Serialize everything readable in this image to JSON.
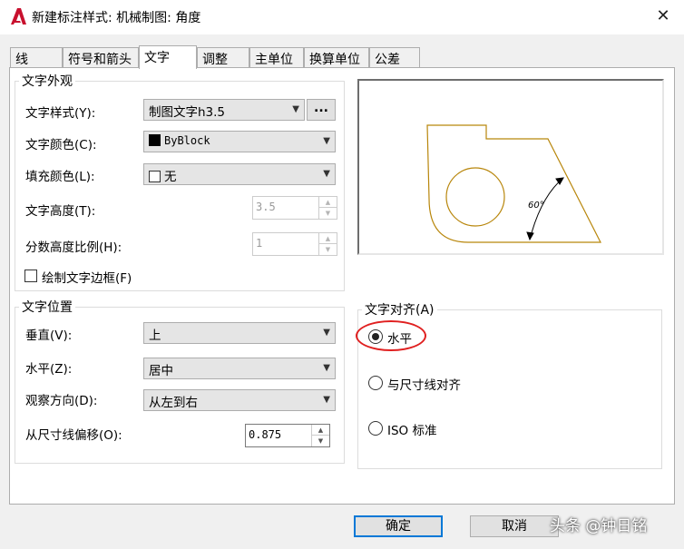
{
  "window": {
    "title": "新建标注样式: 机械制图: 角度",
    "close_glyph": "✕"
  },
  "tabs": [
    {
      "label": "线",
      "active": false
    },
    {
      "label": "符号和箭头",
      "active": false
    },
    {
      "label": "文字",
      "active": true
    },
    {
      "label": "调整",
      "active": false
    },
    {
      "label": "主单位",
      "active": false
    },
    {
      "label": "换算单位",
      "active": false
    },
    {
      "label": "公差",
      "active": false
    }
  ],
  "appearance": {
    "group_label": "文字外观",
    "text_style": {
      "label": "文字样式(Y):",
      "value": "制图文字h3.5",
      "browse": "..."
    },
    "text_color": {
      "label": "文字颜色(C):",
      "value": "ByBlock",
      "swatch": "#000000"
    },
    "fill_color": {
      "label": "填充颜色(L):",
      "value": "无"
    },
    "text_height": {
      "label": "文字高度(T):",
      "value": "3.5"
    },
    "fraction_scale": {
      "label": "分数高度比例(H):",
      "value": "1"
    },
    "draw_frame": {
      "label": "绘制文字边框(F)",
      "checked": false
    }
  },
  "placement": {
    "group_label": "文字位置",
    "vertical": {
      "label": "垂直(V):",
      "value": "上"
    },
    "horizontal": {
      "label": "水平(Z):",
      "value": "居中"
    },
    "view_direction": {
      "label": "观察方向(D):",
      "value": "从左到右"
    },
    "offset": {
      "label": "从尺寸线偏移(O):",
      "value": "0.875"
    }
  },
  "alignment": {
    "group_label": "文字对齐(A)",
    "options": [
      {
        "label": "水平",
        "checked": true
      },
      {
        "label": "与尺寸线对齐",
        "checked": false
      },
      {
        "label": "ISO 标准",
        "checked": false
      }
    ]
  },
  "preview": {
    "angle_label": "60°",
    "stroke_color": "#b8860b"
  },
  "buttons": {
    "ok": "确定",
    "cancel": "取消"
  },
  "watermark": "头条 @钟日铭",
  "colors": {
    "accent": "#0078d7",
    "annotation_red": "#e02020",
    "app_icon_red": "#c8102e"
  }
}
